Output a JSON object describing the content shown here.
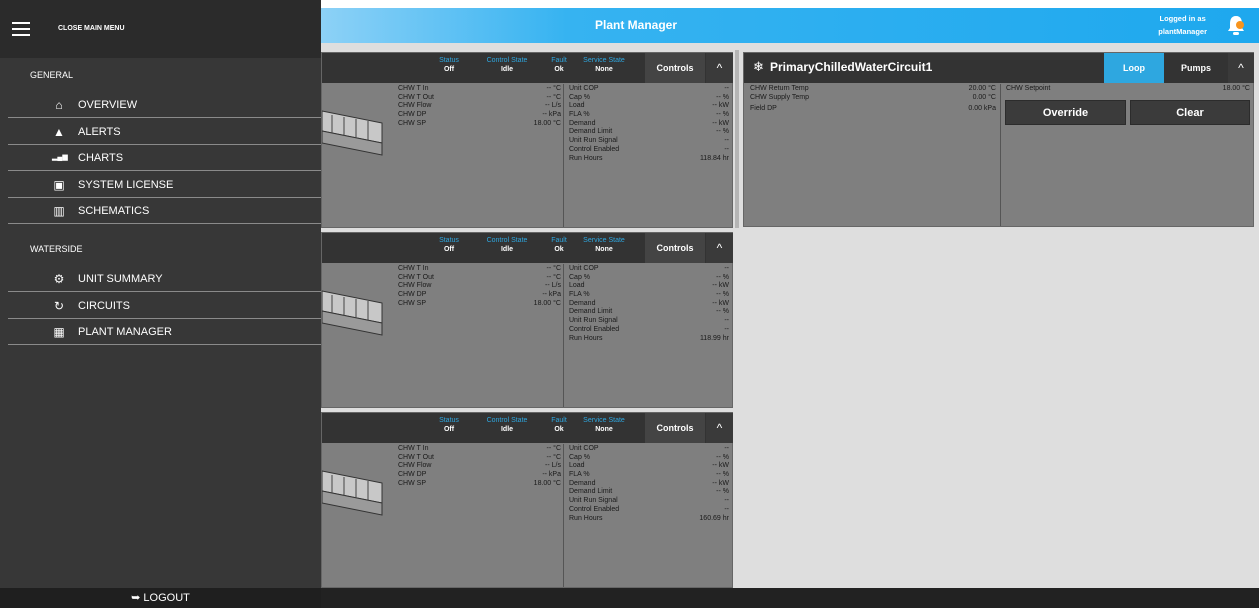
{
  "header": {
    "title": "Plant Manager",
    "logged_line1": "Logged in as",
    "logged_line2": "plantManager"
  },
  "menu": {
    "close_label": "CLOSE MAIN MENU",
    "general_label": "GENERAL",
    "general_items": [
      {
        "label": "OVERVIEW",
        "icon": "home-icon"
      },
      {
        "label": "ALERTS",
        "icon": "warning-icon"
      },
      {
        "label": "CHARTS",
        "icon": "bar-chart-icon"
      },
      {
        "label": "SYSTEM LICENSE",
        "icon": "license-icon"
      },
      {
        "label": "SCHEMATICS",
        "icon": "map-icon"
      }
    ],
    "waterside_label": "WATERSIDE",
    "waterside_items": [
      {
        "label": "UNIT SUMMARY",
        "icon": "gear-icon"
      },
      {
        "label": "CIRCUITS",
        "icon": "refresh-icon"
      },
      {
        "label": "PLANT MANAGER",
        "icon": "building-icon"
      }
    ],
    "logout": "LOGOUT"
  },
  "units": [
    {
      "status_key": "Status",
      "status": "Off",
      "control_key": "Control State",
      "control": "Idle",
      "fault_key": "Fault",
      "fault": "Ok",
      "service_key": "Service State",
      "service": "None",
      "controls_label": "Controls",
      "chevron": "^",
      "left_rows": [
        [
          "CHW T In",
          "-- °C"
        ],
        [
          "CHW T Out",
          "-- °C"
        ],
        [
          "CHW Flow",
          "-- L/s"
        ],
        [
          "CHW DP",
          "-- kPa"
        ],
        [
          "CHW SP",
          "18.00 °C"
        ]
      ],
      "right_rows": [
        [
          "Unit COP",
          "--"
        ],
        [
          "Cap %",
          "-- %"
        ],
        [
          "Load",
          "-- kW"
        ],
        [
          "FLA %",
          "-- %"
        ],
        [
          "Demand",
          "-- kW"
        ],
        [
          "Demand Limit",
          "-- %"
        ],
        [
          "Unit Run Signal",
          "--"
        ],
        [
          "Control Enabled",
          "--"
        ],
        [
          "Run Hours",
          "118.84 hr"
        ]
      ]
    },
    {
      "status_key": "Status",
      "status": "Off",
      "control_key": "Control State",
      "control": "Idle",
      "fault_key": "Fault",
      "fault": "Ok",
      "service_key": "Service State",
      "service": "None",
      "controls_label": "Controls",
      "chevron": "^",
      "left_rows": [
        [
          "CHW T In",
          "-- °C"
        ],
        [
          "CHW T Out",
          "-- °C"
        ],
        [
          "CHW Flow",
          "-- L/s"
        ],
        [
          "CHW DP",
          "-- kPa"
        ],
        [
          "CHW SP",
          "18.00 °C"
        ]
      ],
      "right_rows": [
        [
          "Unit COP",
          "--"
        ],
        [
          "Cap %",
          "-- %"
        ],
        [
          "Load",
          "-- kW"
        ],
        [
          "FLA %",
          "-- %"
        ],
        [
          "Demand",
          "-- kW"
        ],
        [
          "Demand Limit",
          "-- %"
        ],
        [
          "Unit Run Signal",
          "--"
        ],
        [
          "Control Enabled",
          "--"
        ],
        [
          "Run Hours",
          "118.99 hr"
        ]
      ]
    },
    {
      "status_key": "Status",
      "status": "Off",
      "control_key": "Control State",
      "control": "Idle",
      "fault_key": "Fault",
      "fault": "Ok",
      "service_key": "Service State",
      "service": "None",
      "controls_label": "Controls",
      "chevron": "^",
      "left_rows": [
        [
          "CHW T In",
          "-- °C"
        ],
        [
          "CHW T Out",
          "-- °C"
        ],
        [
          "CHW Flow",
          "-- L/s"
        ],
        [
          "CHW DP",
          "-- kPa"
        ],
        [
          "CHW SP",
          "18.00 °C"
        ]
      ],
      "right_rows": [
        [
          "Unit COP",
          "--"
        ],
        [
          "Cap %",
          "-- %"
        ],
        [
          "Load",
          "-- kW"
        ],
        [
          "FLA %",
          "-- %"
        ],
        [
          "Demand",
          "-- kW"
        ],
        [
          "Demand Limit",
          "-- %"
        ],
        [
          "Unit Run Signal",
          "--"
        ],
        [
          "Control Enabled",
          "--"
        ],
        [
          "Run Hours",
          "160.69 hr"
        ]
      ]
    }
  ],
  "loop": {
    "title": "PrimaryChilledWaterCircuit1",
    "tab_loop": "Loop",
    "tab_pumps": "Pumps",
    "chevron": "^",
    "left_rows": [
      [
        "CHW Return Temp",
        "20.00 °C"
      ],
      [
        "CHW Supply Temp",
        "0.00 °C"
      ],
      [
        "Field DP",
        "0.00 kPa"
      ]
    ],
    "setpoint_label": "CHW Setpoint",
    "setpoint_value": "18.00 °C",
    "override_label": "Override",
    "clear_label": "Clear"
  },
  "colors": {
    "accent": "#1ea8ee",
    "menu_bg": "#373737",
    "panel_bg": "#7f7f7f"
  }
}
